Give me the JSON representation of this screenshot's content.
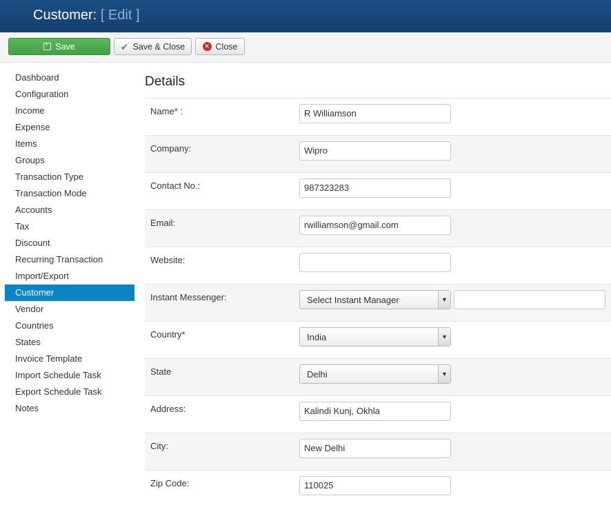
{
  "header": {
    "title": "Customer:",
    "subtitle": "[ Edit ]"
  },
  "toolbar": {
    "save_label": "Save",
    "save_close_label": "Save & Close",
    "close_label": "Close"
  },
  "sidebar": {
    "items": [
      {
        "label": "Dashboard"
      },
      {
        "label": "Configuration"
      },
      {
        "label": "Income"
      },
      {
        "label": "Expense"
      },
      {
        "label": "Items"
      },
      {
        "label": "Groups"
      },
      {
        "label": "Transaction Type"
      },
      {
        "label": "Transaction Mode"
      },
      {
        "label": "Accounts"
      },
      {
        "label": "Tax"
      },
      {
        "label": "Discount"
      },
      {
        "label": "Recurring Transaction"
      },
      {
        "label": "Import/Export"
      },
      {
        "label": "Customer",
        "active": true
      },
      {
        "label": "Vendor"
      },
      {
        "label": "Countries"
      },
      {
        "label": "States"
      },
      {
        "label": "Invoice Template"
      },
      {
        "label": "Import Schedule Task"
      },
      {
        "label": "Export Schedule Task"
      },
      {
        "label": "Notes"
      }
    ]
  },
  "main": {
    "title": "Details",
    "fields": {
      "name": {
        "label": "Name",
        "required_mark": "*",
        "suffix": " :",
        "value": "R Williamson"
      },
      "company": {
        "label": "Company:",
        "value": "Wipro"
      },
      "contact": {
        "label": "Contact No.:",
        "value": "987323283"
      },
      "email": {
        "label": "Email:",
        "value": "rwilliamson@gmail.com"
      },
      "website": {
        "label": "Website:",
        "value": ""
      },
      "im": {
        "label": "Instant Messenger:",
        "selected": "Select Instant Manager",
        "value": ""
      },
      "country": {
        "label": "Country",
        "required_mark": "*",
        "selected": "India"
      },
      "state": {
        "label": "State",
        "selected": "Delhi"
      },
      "address": {
        "label": "Address:",
        "value": "Kalindi Kunj, Okhla"
      },
      "city": {
        "label": "City:",
        "value": "New Delhi"
      },
      "zip": {
        "label": "Zip Code:",
        "value": "110025"
      }
    }
  },
  "colors": {
    "header_bg": "#1a4a7e",
    "save_button": "#4ea64e",
    "active_nav": "#0b84c6",
    "required": "#cc0000"
  },
  "icons": {
    "save": "edit-icon",
    "save_close": "check-icon",
    "close": "close-circle-icon",
    "select_arrow": "chevron-down-icon"
  }
}
